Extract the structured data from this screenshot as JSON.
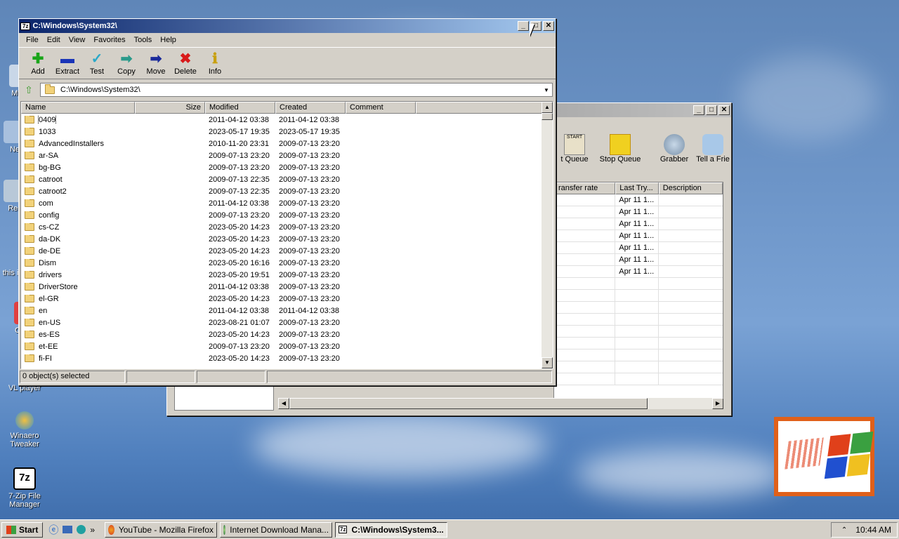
{
  "desktop": {
    "icons": [
      {
        "label": "My C",
        "name": "my-computer"
      },
      {
        "label": "Ne",
        "name": "network"
      },
      {
        "label": "Rec",
        "name": "recycle-bin"
      },
      {
        "label": "this i",
        "name": "this-item"
      },
      {
        "label": "C",
        "name": "c-item"
      },
      {
        "label": "VL player",
        "name": "vlc-player"
      },
      {
        "label": "Winaero Tweaker",
        "name": "winaero-tweaker"
      },
      {
        "label": "7-Zip File Manager",
        "name": "7zip-file-manager"
      }
    ]
  },
  "idm": {
    "toolbar": [
      "t Queue",
      "Stop Queue",
      "Grabber",
      "Tell a Frie"
    ],
    "columns": [
      "ransfer rate",
      "Last Try...",
      "Description"
    ],
    "last_try": [
      "Apr 11 1...",
      "Apr 11 1...",
      "Apr 11 1...",
      "Apr 11 1...",
      "Apr 11 1...",
      "Apr 11 1...",
      "Apr 11 1..."
    ]
  },
  "sevenzip": {
    "title": "C:\\Windows\\System32\\",
    "title_icon": "7z",
    "menu": [
      "File",
      "Edit",
      "View",
      "Favorites",
      "Tools",
      "Help"
    ],
    "toolbar": [
      {
        "label": "Add",
        "glyph": "✚",
        "color": "#1aa51a"
      },
      {
        "label": "Extract",
        "glyph": "▬",
        "color": "#1a35b8"
      },
      {
        "label": "Test",
        "glyph": "✓",
        "color": "#2aa8c8"
      },
      {
        "label": "Copy",
        "glyph": "➡",
        "color": "#2a9a8a"
      },
      {
        "label": "Move",
        "glyph": "➡",
        "color": "#1a2a9a"
      },
      {
        "label": "Delete",
        "glyph": "✖",
        "color": "#d81a1a"
      },
      {
        "label": "Info",
        "glyph": "ℹ",
        "color": "#c8a010"
      }
    ],
    "address": "C:\\Windows\\System32\\",
    "columns": [
      "Name",
      "Size",
      "Modified",
      "Created",
      "Comment"
    ],
    "rows": [
      [
        "0409",
        "",
        "2011-04-12 03:38",
        "2011-04-12 03:38"
      ],
      [
        "1033",
        "",
        "2023-05-17 19:35",
        "2023-05-17 19:35"
      ],
      [
        "AdvancedInstallers",
        "",
        "2010-11-20 23:31",
        "2009-07-13 23:20"
      ],
      [
        "ar-SA",
        "",
        "2009-07-13 23:20",
        "2009-07-13 23:20"
      ],
      [
        "bg-BG",
        "",
        "2009-07-13 23:20",
        "2009-07-13 23:20"
      ],
      [
        "catroot",
        "",
        "2009-07-13 22:35",
        "2009-07-13 23:20"
      ],
      [
        "catroot2",
        "",
        "2009-07-13 22:35",
        "2009-07-13 23:20"
      ],
      [
        "com",
        "",
        "2011-04-12 03:38",
        "2009-07-13 23:20"
      ],
      [
        "config",
        "",
        "2009-07-13 23:20",
        "2009-07-13 23:20"
      ],
      [
        "cs-CZ",
        "",
        "2023-05-20 14:23",
        "2009-07-13 23:20"
      ],
      [
        "da-DK",
        "",
        "2023-05-20 14:23",
        "2009-07-13 23:20"
      ],
      [
        "de-DE",
        "",
        "2023-05-20 14:23",
        "2009-07-13 23:20"
      ],
      [
        "Dism",
        "",
        "2023-05-20 16:16",
        "2009-07-13 23:20"
      ],
      [
        "drivers",
        "",
        "2023-05-20 19:51",
        "2009-07-13 23:20"
      ],
      [
        "DriverStore",
        "",
        "2011-04-12 03:38",
        "2009-07-13 23:20"
      ],
      [
        "el-GR",
        "",
        "2023-05-20 14:23",
        "2009-07-13 23:20"
      ],
      [
        "en",
        "",
        "2011-04-12 03:38",
        "2011-04-12 03:38"
      ],
      [
        "en-US",
        "",
        "2023-08-21 01:07",
        "2009-07-13 23:20"
      ],
      [
        "es-ES",
        "",
        "2023-05-20 14:23",
        "2009-07-13 23:20"
      ],
      [
        "et-EE",
        "",
        "2009-07-13 23:20",
        "2009-07-13 23:20"
      ],
      [
        "fi-FI",
        "",
        "2023-05-20 14:23",
        "2009-07-13 23:20"
      ]
    ],
    "status": "0 object(s) selected"
  },
  "taskbar": {
    "start": "Start",
    "tasks": [
      {
        "label": "YouTube - Mozilla Firefox"
      },
      {
        "label": "Internet Download Mana..."
      },
      {
        "label": "C:\\Windows\\System3..."
      }
    ],
    "clock": "10:44 AM"
  }
}
